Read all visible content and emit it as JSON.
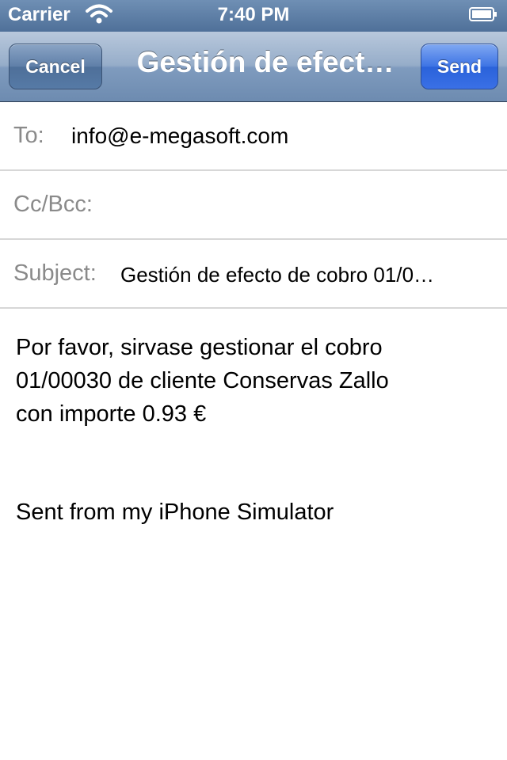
{
  "status_bar": {
    "carrier": "Carrier",
    "time": "7:40 PM",
    "icons": [
      "wifi-icon",
      "battery-icon"
    ]
  },
  "nav": {
    "cancel_label": "Cancel",
    "title": "Gestión de efect…",
    "send_label": "Send"
  },
  "fields": {
    "to_label": "To:",
    "to_value": "info@e-megasoft.com",
    "ccbcc_label": "Cc/Bcc:",
    "ccbcc_value": "",
    "subject_label": "Subject:",
    "subject_value": "Gestión de efecto de cobro 01/0…"
  },
  "message": {
    "line1": "Por favor, sirvase gestionar el cobro",
    "line2": "01/00030 de cliente Conservas Zallo",
    "line3": "con importe 0.93 €",
    "signature": "Sent from my iPhone Simulator"
  },
  "colors": {
    "nav_bar": "#7f9bbe",
    "send_button": "#3d73e4",
    "label_gray": "#8a8a8a"
  }
}
